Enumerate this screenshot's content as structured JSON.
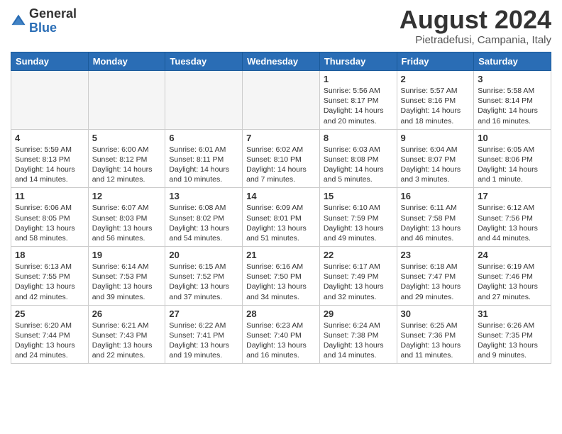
{
  "logo": {
    "general": "General",
    "blue": "Blue"
  },
  "title": "August 2024",
  "location": "Pietradefusi, Campania, Italy",
  "days": [
    "Sunday",
    "Monday",
    "Tuesday",
    "Wednesday",
    "Thursday",
    "Friday",
    "Saturday"
  ],
  "weeks": [
    [
      {
        "day": "",
        "info": ""
      },
      {
        "day": "",
        "info": ""
      },
      {
        "day": "",
        "info": ""
      },
      {
        "day": "",
        "info": ""
      },
      {
        "day": "1",
        "info": "Sunrise: 5:56 AM\nSunset: 8:17 PM\nDaylight: 14 hours\nand 20 minutes."
      },
      {
        "day": "2",
        "info": "Sunrise: 5:57 AM\nSunset: 8:16 PM\nDaylight: 14 hours\nand 18 minutes."
      },
      {
        "day": "3",
        "info": "Sunrise: 5:58 AM\nSunset: 8:14 PM\nDaylight: 14 hours\nand 16 minutes."
      }
    ],
    [
      {
        "day": "4",
        "info": "Sunrise: 5:59 AM\nSunset: 8:13 PM\nDaylight: 14 hours\nand 14 minutes."
      },
      {
        "day": "5",
        "info": "Sunrise: 6:00 AM\nSunset: 8:12 PM\nDaylight: 14 hours\nand 12 minutes."
      },
      {
        "day": "6",
        "info": "Sunrise: 6:01 AM\nSunset: 8:11 PM\nDaylight: 14 hours\nand 10 minutes."
      },
      {
        "day": "7",
        "info": "Sunrise: 6:02 AM\nSunset: 8:10 PM\nDaylight: 14 hours\nand 7 minutes."
      },
      {
        "day": "8",
        "info": "Sunrise: 6:03 AM\nSunset: 8:08 PM\nDaylight: 14 hours\nand 5 minutes."
      },
      {
        "day": "9",
        "info": "Sunrise: 6:04 AM\nSunset: 8:07 PM\nDaylight: 14 hours\nand 3 minutes."
      },
      {
        "day": "10",
        "info": "Sunrise: 6:05 AM\nSunset: 8:06 PM\nDaylight: 14 hours\nand 1 minute."
      }
    ],
    [
      {
        "day": "11",
        "info": "Sunrise: 6:06 AM\nSunset: 8:05 PM\nDaylight: 13 hours\nand 58 minutes."
      },
      {
        "day": "12",
        "info": "Sunrise: 6:07 AM\nSunset: 8:03 PM\nDaylight: 13 hours\nand 56 minutes."
      },
      {
        "day": "13",
        "info": "Sunrise: 6:08 AM\nSunset: 8:02 PM\nDaylight: 13 hours\nand 54 minutes."
      },
      {
        "day": "14",
        "info": "Sunrise: 6:09 AM\nSunset: 8:01 PM\nDaylight: 13 hours\nand 51 minutes."
      },
      {
        "day": "15",
        "info": "Sunrise: 6:10 AM\nSunset: 7:59 PM\nDaylight: 13 hours\nand 49 minutes."
      },
      {
        "day": "16",
        "info": "Sunrise: 6:11 AM\nSunset: 7:58 PM\nDaylight: 13 hours\nand 46 minutes."
      },
      {
        "day": "17",
        "info": "Sunrise: 6:12 AM\nSunset: 7:56 PM\nDaylight: 13 hours\nand 44 minutes."
      }
    ],
    [
      {
        "day": "18",
        "info": "Sunrise: 6:13 AM\nSunset: 7:55 PM\nDaylight: 13 hours\nand 42 minutes."
      },
      {
        "day": "19",
        "info": "Sunrise: 6:14 AM\nSunset: 7:53 PM\nDaylight: 13 hours\nand 39 minutes."
      },
      {
        "day": "20",
        "info": "Sunrise: 6:15 AM\nSunset: 7:52 PM\nDaylight: 13 hours\nand 37 minutes."
      },
      {
        "day": "21",
        "info": "Sunrise: 6:16 AM\nSunset: 7:50 PM\nDaylight: 13 hours\nand 34 minutes."
      },
      {
        "day": "22",
        "info": "Sunrise: 6:17 AM\nSunset: 7:49 PM\nDaylight: 13 hours\nand 32 minutes."
      },
      {
        "day": "23",
        "info": "Sunrise: 6:18 AM\nSunset: 7:47 PM\nDaylight: 13 hours\nand 29 minutes."
      },
      {
        "day": "24",
        "info": "Sunrise: 6:19 AM\nSunset: 7:46 PM\nDaylight: 13 hours\nand 27 minutes."
      }
    ],
    [
      {
        "day": "25",
        "info": "Sunrise: 6:20 AM\nSunset: 7:44 PM\nDaylight: 13 hours\nand 24 minutes."
      },
      {
        "day": "26",
        "info": "Sunrise: 6:21 AM\nSunset: 7:43 PM\nDaylight: 13 hours\nand 22 minutes."
      },
      {
        "day": "27",
        "info": "Sunrise: 6:22 AM\nSunset: 7:41 PM\nDaylight: 13 hours\nand 19 minutes."
      },
      {
        "day": "28",
        "info": "Sunrise: 6:23 AM\nSunset: 7:40 PM\nDaylight: 13 hours\nand 16 minutes."
      },
      {
        "day": "29",
        "info": "Sunrise: 6:24 AM\nSunset: 7:38 PM\nDaylight: 13 hours\nand 14 minutes."
      },
      {
        "day": "30",
        "info": "Sunrise: 6:25 AM\nSunset: 7:36 PM\nDaylight: 13 hours\nand 11 minutes."
      },
      {
        "day": "31",
        "info": "Sunrise: 6:26 AM\nSunset: 7:35 PM\nDaylight: 13 hours\nand 9 minutes."
      }
    ]
  ],
  "colors": {
    "header_bg": "#2a6db5",
    "header_text": "#ffffff",
    "border": "#cccccc",
    "empty_bg": "#f5f5f5"
  }
}
